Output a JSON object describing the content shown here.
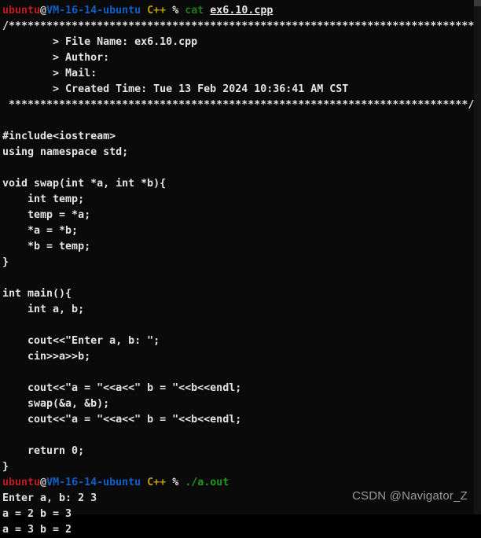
{
  "terminal": {
    "background_color": "#0a0a0a",
    "foreground_color": "#d8d8d8",
    "colors": {
      "user_red": "#c01c1c",
      "host_blue": "#1060c8",
      "dir_yellow": "#bfa000",
      "command_green": "#1d7a1d",
      "run_green": "#1d9a1d",
      "text_white": "#e4e4e4",
      "watermark_gray": "#9a9a9a"
    },
    "prompt_1": {
      "user": "ubuntu",
      "at": "@",
      "host": "VM-16-14-ubuntu",
      "dir": "C++",
      "symbol": "%",
      "command": "cat",
      "argument": "ex6.10.cpp"
    },
    "prompt_2": {
      "user": "ubuntu",
      "at": "@",
      "host": "VM-16-14-ubuntu",
      "dir": "C++",
      "symbol": "%",
      "command": "./a.out"
    },
    "file_header": {
      "top_rule": "/**************************************************************************",
      "file_name_line": "        > File Name: ex6.10.cpp",
      "author_line": "        > Author: ",
      "mail_line": "        > Mail: ",
      "created_time_line": "        > Created Time: Tue 13 Feb 2024 10:36:41 AM CST",
      "bottom_rule": " *************************************************************************/"
    },
    "source_lines": [
      "",
      "#include<iostream>",
      "using namespace std;",
      "",
      "void swap(int *a, int *b){",
      "    int temp;",
      "    temp = *a;",
      "    *a = *b;",
      "    *b = temp;",
      "}",
      "",
      "int main(){",
      "    int a, b;",
      "",
      "    cout<<\"Enter a, b: \";",
      "    cin>>a>>b;",
      "",
      "    cout<<\"a = \"<<a<<\" b = \"<<b<<endl;",
      "    swap(&a, &b);",
      "    cout<<\"a = \"<<a<<\" b = \"<<b<<endl;",
      "",
      "    return 0;",
      "}"
    ],
    "program_output": [
      "Enter a, b: 2 3",
      "a = 2 b = 3",
      "a = 3 b = 2"
    ],
    "watermark": "CSDN @Navigator_Z"
  }
}
